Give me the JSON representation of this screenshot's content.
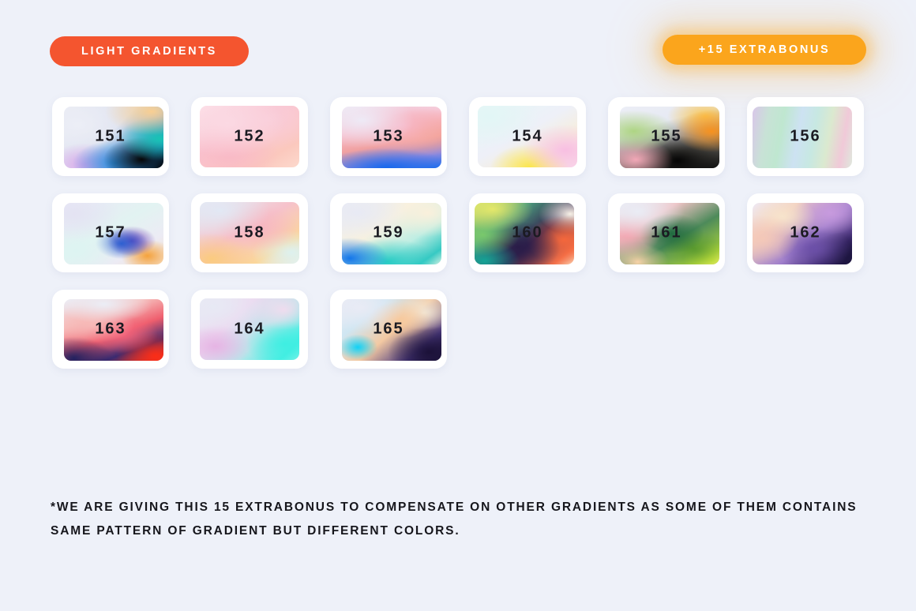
{
  "header": {
    "left_badge": "LIGHT GRADIENTS",
    "right_badge": "+15 EXTRABONUS",
    "left_badge_color": "#f4552f",
    "right_badge_color": "#fba51c"
  },
  "page": {
    "background_color": "#eef1f9",
    "card_color": "#ffffff",
    "number_color": "#1b1b22"
  },
  "footnote": {
    "text": "*WE ARE GIVING THIS 15 EXTRABONUS TO COMPENSATE ON OTHER GRADIENTS AS SOME OF THEM CONTAINS SAME PATTERN OF GRADIENT BUT DIFFERENT COLORS."
  },
  "rows": [
    {
      "cards": [
        {
          "label": "151",
          "offset": "off-right",
          "colors": [
            "#e6e7f0",
            "#f9c98e",
            "#15c3b8",
            "#1d7fd6",
            "#0a0a0a",
            "#b07fd8",
            "#f3c8e8"
          ],
          "css": "radial-gradient(85% 70% at 88% 8%, #f9cf92 0%, rgba(249,207,146,0) 55%), radial-gradient(70% 60% at 96% 52%, #18c4b4 0%, rgba(24,196,180,0) 60%), radial-gradient(62% 58% at 78% 86%, #070707 0%, rgba(7,7,7,0) 62%), radial-gradient(70% 60% at 52% 92%, #2b8fe0 0%, rgba(43,143,224,0) 62%), radial-gradient(62% 55% at 22% 95%, #d9a6ea 0%, rgba(217,166,234,0) 65%), radial-gradient(70% 70% at 14% 30%, #eceef6 0%, rgba(236,238,246,0) 70%), linear-gradient(135deg,#e9ebf4 0%,#dfe3f0 45%,#1c78c9 85%,#000000 100%)"
        },
        {
          "label": "152",
          "offset": "off-mid",
          "colors": [
            "#fbdde4",
            "#f9c7d6",
            "#f7b2c3",
            "#fcd4cc"
          ],
          "css": "radial-gradient(80% 80% at 28% 28%, #fbd9e3 0%, rgba(251,217,227,0) 70%), radial-gradient(75% 70% at 68% 22%, #f9cdd9 0%, rgba(249,205,217,0) 70%), radial-gradient(70% 70% at 30% 78%, #f9b9c6 0%, rgba(249,185,198,0) 70%), linear-gradient(150deg,#fce3ea 0%,#f9c5d1 40%,#fbc8bd 78%,#fcd9cd 100%)"
        },
        {
          "label": "153",
          "offset": "off-right",
          "colors": [
            "#ece9f4",
            "#f8c9d8",
            "#f4a096",
            "#6d7fd8",
            "#1d6ef0"
          ],
          "css": "radial-gradient(75% 65% at 20% 22%, #eeeaf6 0%, rgba(238,234,246,0) 70%), radial-gradient(80% 60% at 58% 30%, #f7b7c8 0%, rgba(247,183,200,0) 70%), radial-gradient(70% 55% at 82% 42%, #f4a18f 0%, rgba(244,161,143,0) 70%), radial-gradient(90% 45% at 45% 100%, #1768ec 0%, rgba(23,104,236,0) 72%), linear-gradient(170deg,#efeaf5 0%,#f8bccb 35%,#f0a1a1 58%,#8f8ade 80%,#1f6fee 100%)"
        },
        {
          "label": "154",
          "offset": "off-mid",
          "colors": [
            "#e4f6f6",
            "#eef0f8",
            "#fbe84f",
            "#f7c0e2"
          ],
          "css": "radial-gradient(70% 70% at 12% 18%, #e2f6f6 0%, rgba(226,246,246,0) 72%), radial-gradient(62% 60% at 88% 72%, #f8bfe2 0%, rgba(248,191,226,0) 70%), radial-gradient(55% 52% at 52% 100%, #fbe64c 0%, rgba(251,230,76,0) 72%), linear-gradient(150deg,#e6f6f6 0%,#eef0f8 45%,#f6eedd 70%,#f9d9ec 100%)"
        },
        {
          "label": "155",
          "offset": "off-right",
          "colors": [
            "#e9ebf4",
            "#a7d37a",
            "#f0a6b6",
            "#0a0a0a",
            "#f79121",
            "#fbc24a"
          ],
          "css": "radial-gradient(70% 55% at 14% 40%, #aed583 0%, rgba(174,213,131,0) 62%), radial-gradient(55% 50% at 16% 86%, #f2a8b7 0%, rgba(242,168,183,0) 68%), radial-gradient(60% 55% at 92% 40%, #f7921f 0%, rgba(247,146,31,0) 62%), radial-gradient(58% 50% at 86% 16%, #fbc64f 0%, rgba(251,198,79,0) 66%), radial-gradient(68% 62% at 58% 88%, #050505 0%, rgba(5,5,5,0) 66%), linear-gradient(165deg,#eceef6 0%,#e6e9f3 30%,#5c5a54 70%,#121212 100%)"
        },
        {
          "label": "156",
          "offset": "off-left",
          "colors": [
            "#d8c4e8",
            "#bfe6cf",
            "#cfe4f5",
            "#f2cbd9",
            "#d7ebd5"
          ],
          "css": "linear-gradient(100deg,#d9c6e9 0%,#c8e2d6 16%,#bfe7d0 30%,#cde2f2 46%,#c7e8e2 60%,#dbe9cf 74%,#f0c9d8 88%,#dfe8dd 100%)"
        }
      ]
    },
    {
      "cards": [
        {
          "label": "157",
          "offset": "off-right",
          "colors": [
            "#e8eaf5",
            "#dff4f4",
            "#2e5fd0",
            "#6b3fb5",
            "#f5a23c"
          ],
          "css": "radial-gradient(65% 60% at 10% 18%, #e4e3f3 0%, rgba(228,227,243,0) 72%), radial-gradient(60% 60% at 12% 78%, #ddf4f2 0%, rgba(221,244,242,0) 72%), radial-gradient(38% 36% at 58% 66%, #2d5fd1 0%, rgba(45,95,209,0) 70%), radial-gradient(34% 34% at 68% 62%, #6b3fb5 0%, rgba(107,63,181,0) 72%), radial-gradient(38% 38% at 84% 86%, #f5a23c 0%, rgba(245,162,60,0) 70%), linear-gradient(150deg,#e9e8f5 0%,#e2f3f2 45%,#ecebf4 75%,#f7e4cf 100%)"
        },
        {
          "label": "158",
          "offset": "off-mid",
          "colors": [
            "#e3e8f3",
            "#f7b5c0",
            "#f9c87e",
            "#fbe3b0",
            "#e0f2f0"
          ],
          "css": "radial-gradient(70% 60% at 20% 14%, #e2e8f4 0%, rgba(226,232,244,0) 72%), radial-gradient(60% 55% at 58% 42%, #f7b6c1 0%, rgba(247,182,193,0) 70%), radial-gradient(62% 58% at 12% 92%, #fbcb7f 0%, rgba(251,203,127,0) 72%), radial-gradient(55% 50% at 92% 82%, #ddf1ef 0%, rgba(221,241,239,0) 72%), linear-gradient(150deg,#e5eaf4 0%,#f6c2cb 45%,#fbd79a 78%,#eaf3f0 100%)"
        },
        {
          "label": "159",
          "offset": "off-right",
          "colors": [
            "#e8eaf4",
            "#faf0dc",
            "#cff2e8",
            "#1479e8",
            "#23c9c4"
          ],
          "css": "radial-gradient(70% 60% at 16% 16%, #e8eaf4 0%, rgba(232,234,244,0) 72%), radial-gradient(60% 55% at 86% 16%, #faf0dc 0%, rgba(250,240,220,0) 72%), radial-gradient(55% 48% at 8% 90%, #1376ea 0%, rgba(19,118,234,0) 70%), radial-gradient(70% 55% at 46% 96%, #26cbc4 0%, rgba(38,203,196,0) 70%), linear-gradient(145deg,#eaecf5 0%,#f7f1e0 38%,#bfeee3 66%,#37c9c3 88%,#cef0e2 100%)"
        },
        {
          "label": "160",
          "offset": "off-left",
          "colors": [
            "#e2e86a",
            "#7ec86a",
            "#1aa394",
            "#2e1f4d",
            "#f4673c",
            "#f9a67d"
          ],
          "css": "radial-gradient(62% 55% at 18% 10%, #e4e86a 0%, rgba(228,232,106,0) 66%), radial-gradient(55% 50% at 8% 52%, #79c86c 0%, rgba(121,200,108,0) 68%), radial-gradient(52% 48% at 10% 94%, #14a396 0%, rgba(20,163,150,0) 68%), radial-gradient(62% 62% at 44% 72%, #2a1c48 0%, rgba(42,28,72,0) 68%), radial-gradient(58% 60% at 90% 60%, #f4673c 0%, rgba(244,103,60,0) 66%), radial-gradient(45% 45% at 96% 18%, #f7f1e6 0%, rgba(247,241,230,0) 70%), linear-gradient(140deg,#d9e46b 0%,#4c9e7e 30%,#33224f 60%,#f4714a 88%,#fbd3b3 100%)"
        },
        {
          "label": "161",
          "offset": "off-right",
          "colors": [
            "#e9ebf5",
            "#f3a8b4",
            "#1f6b3f",
            "#4e8a2c",
            "#c2e03a",
            "#f6cfa4"
          ],
          "css": "radial-gradient(65% 60% at 18% 14%, #eaecf5 0%, rgba(234,236,245,0) 72%), radial-gradient(48% 52% at 8% 52%, #f3a7b3 0%, rgba(243,167,179,0) 68%), radial-gradient(48% 48% at 52% 50%, #1f6b3f 0%, rgba(31,107,63,0) 68%), radial-gradient(46% 44% at 74% 74%, #5a9a2e 0%, rgba(90,154,46,0) 68%), radial-gradient(40% 40% at 92% 92%, #c6e33a 0%, rgba(198,227,58,0) 70%), radial-gradient(44% 44% at 18% 96%, #f7d2a8 0%, rgba(247,210,168,0) 70%), linear-gradient(150deg,#ebedf6 0%,#eec2c4 28%,#4d8a5a 58%,#a6cf3d 88%,#f3dcb8 100%)"
        },
        {
          "label": "162",
          "offset": "off-left",
          "colors": [
            "#f4cbbc",
            "#f9e0c6",
            "#b98ed4",
            "#6b4fa8",
            "#241a4b",
            "#ece9f5"
          ],
          "css": "radial-gradient(52% 55% at 10% 58%, #f4c8b8 0%, rgba(244,200,184,0) 70%), radial-gradient(48% 46% at 30% 22%, #f7e4cc 0%, rgba(247,228,204,0) 70%), radial-gradient(52% 50% at 78% 16%, #c79ade 0%, rgba(199,154,222,0) 70%), radial-gradient(54% 54% at 62% 74%, #6b4fa8 0%, rgba(107,79,168,0) 68%), radial-gradient(60% 60% at 94% 88%, #1d1540 0%, rgba(29,21,64,0) 68%), linear-gradient(140deg,#eeeaf6 0%,#f2cfc0 26%,#9f7ecb 58%,#3f2a72 82%,#1b1338 100%)"
        }
      ]
    },
    {
      "cards": [
        {
          "label": "163",
          "offset": "off-right",
          "colors": [
            "#e9ebf4",
            "#f6b7b7",
            "#f4637a",
            "#26256b",
            "#fb2d1c",
            "#fc5a2a"
          ],
          "css": "radial-gradient(70% 45% at 40% 8%, #ebedf5 0%, rgba(235,237,245,0) 70%), radial-gradient(62% 45% at 28% 40%, #f7bab8 0%, rgba(247,186,184,0) 70%), radial-gradient(52% 45% at 58% 56%, #f4637a 0%, rgba(244,99,122,0) 70%), radial-gradient(56% 50% at 10% 96%, #23215f 0%, rgba(35,33,95,0) 70%), radial-gradient(58% 56% at 92% 92%, #fb2d17 0%, rgba(251,45,23,0) 68%), linear-gradient(160deg,#eceef6 0%,#f6bcba 30%,#ef5f6e 55%,#3a2a70 78%,#fb3a1e 100%)"
        },
        {
          "label": "164",
          "offset": "off-mid",
          "colors": [
            "#e7e9f4",
            "#efd8ee",
            "#e3a8e0",
            "#4ef0e4",
            "#28e6dd"
          ],
          "css": "radial-gradient(70% 60% at 14% 14%, #e7e9f4 0%, rgba(231,233,244,0) 72%), radial-gradient(52% 50% at 16% 78%, #e6b4e4 0%, rgba(230,180,228,0) 70%), radial-gradient(46% 46% at 84% 18%, #efdcee 0%, rgba(239,220,238,0) 72%), radial-gradient(60% 58% at 86% 74%, #3eeee2 0%, rgba(62,238,226,0) 66%), linear-gradient(135deg,#e9ebf5 0%,#ecd9f0 34%,#b8e6ea 62%,#45efe3 88%,#8ef3ea 100%)"
        },
        {
          "label": "165",
          "offset": "off-right",
          "colors": [
            "#e8eaf4",
            "#17d4f7",
            "#f7c49a",
            "#f3ead6",
            "#2a1a52",
            "#1a1038"
          ],
          "css": "radial-gradient(62% 55% at 18% 14%, #e9ebf5 0%, rgba(233,235,245,0) 72%), radial-gradient(30% 32% at 16% 78%, #10d2f7 0%, rgba(16,210,247,0) 66%), radial-gradient(48% 44% at 58% 34%, #f7c99d 0%, rgba(247,201,157,0) 68%), radial-gradient(44% 42% at 82% 22%, #f2e8d8 0%, rgba(242,232,216,0) 70%), radial-gradient(62% 62% at 88% 86%, #1b1138 0%, rgba(27,17,56,0) 68%), linear-gradient(140deg,#eaecf5 0%,#cfe6f2 26%,#f3c9a2 52%,#4b3a7e 80%,#1a1036 100%)"
        }
      ]
    }
  ]
}
